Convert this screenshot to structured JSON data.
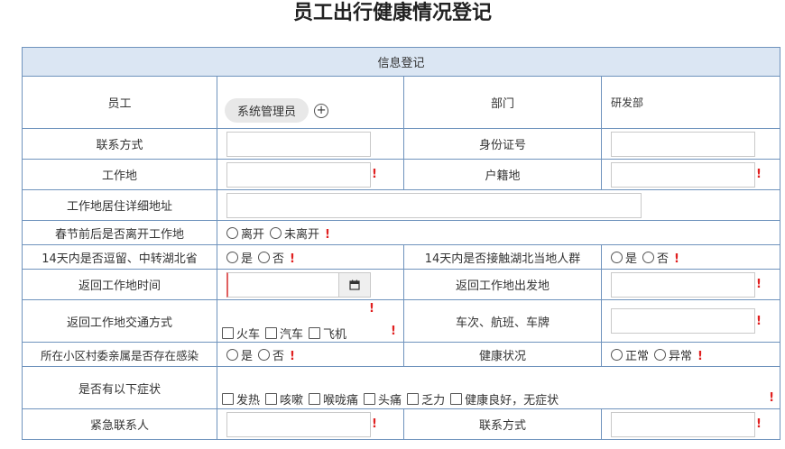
{
  "page_title": "员工出行健康情况登记",
  "section_header": "信息登记",
  "row_employee": {
    "label": "员工",
    "tag": "系统管理员",
    "dept_label": "部门",
    "dept_value": "研发部"
  },
  "row_contact": {
    "label": "联系方式",
    "id_label": "身份证号"
  },
  "row_workplace": {
    "label": "工作地",
    "huji_label": "户籍地"
  },
  "row_address": {
    "label": "工作地居住详细地址"
  },
  "row_leave": {
    "label": "春节前后是否离开工作地",
    "opt1": "离开",
    "opt2": "未离开"
  },
  "row_hubei": {
    "label": "14天内是否逗留、中转湖北省",
    "opt1": "是",
    "opt2": "否",
    "contact_label": "14天内是否接触湖北当地人群",
    "c_opt1": "是",
    "c_opt2": "否"
  },
  "row_return": {
    "label": "返回工作地时间",
    "from_label": "返回工作地出发地"
  },
  "row_transport": {
    "label": "返回工作地交通方式",
    "opt1": "火车",
    "opt2": "汽车",
    "opt3": "飞机",
    "trip_label": "车次、航班、车牌"
  },
  "row_community": {
    "label": "所在小区村委亲属是否存在感染",
    "opt1": "是",
    "opt2": "否",
    "health_label": "健康状况",
    "h_opt1": "正常",
    "h_opt2": "异常"
  },
  "row_symptoms": {
    "label": "是否有以下症状",
    "opts": [
      "发热",
      "咳嗽",
      "喉咙痛",
      "头痛",
      "乏力",
      "健康良好，无症状"
    ]
  },
  "row_emergency": {
    "label": "紧急联系人",
    "phone_label": "联系方式"
  },
  "required_mark": "!",
  "colors": {
    "border": "#6f93bd",
    "header_bg": "#dbe6f3",
    "required": "#e02020"
  },
  "icons": {
    "add": "plus-circle-icon",
    "calendar": "calendar-icon"
  }
}
